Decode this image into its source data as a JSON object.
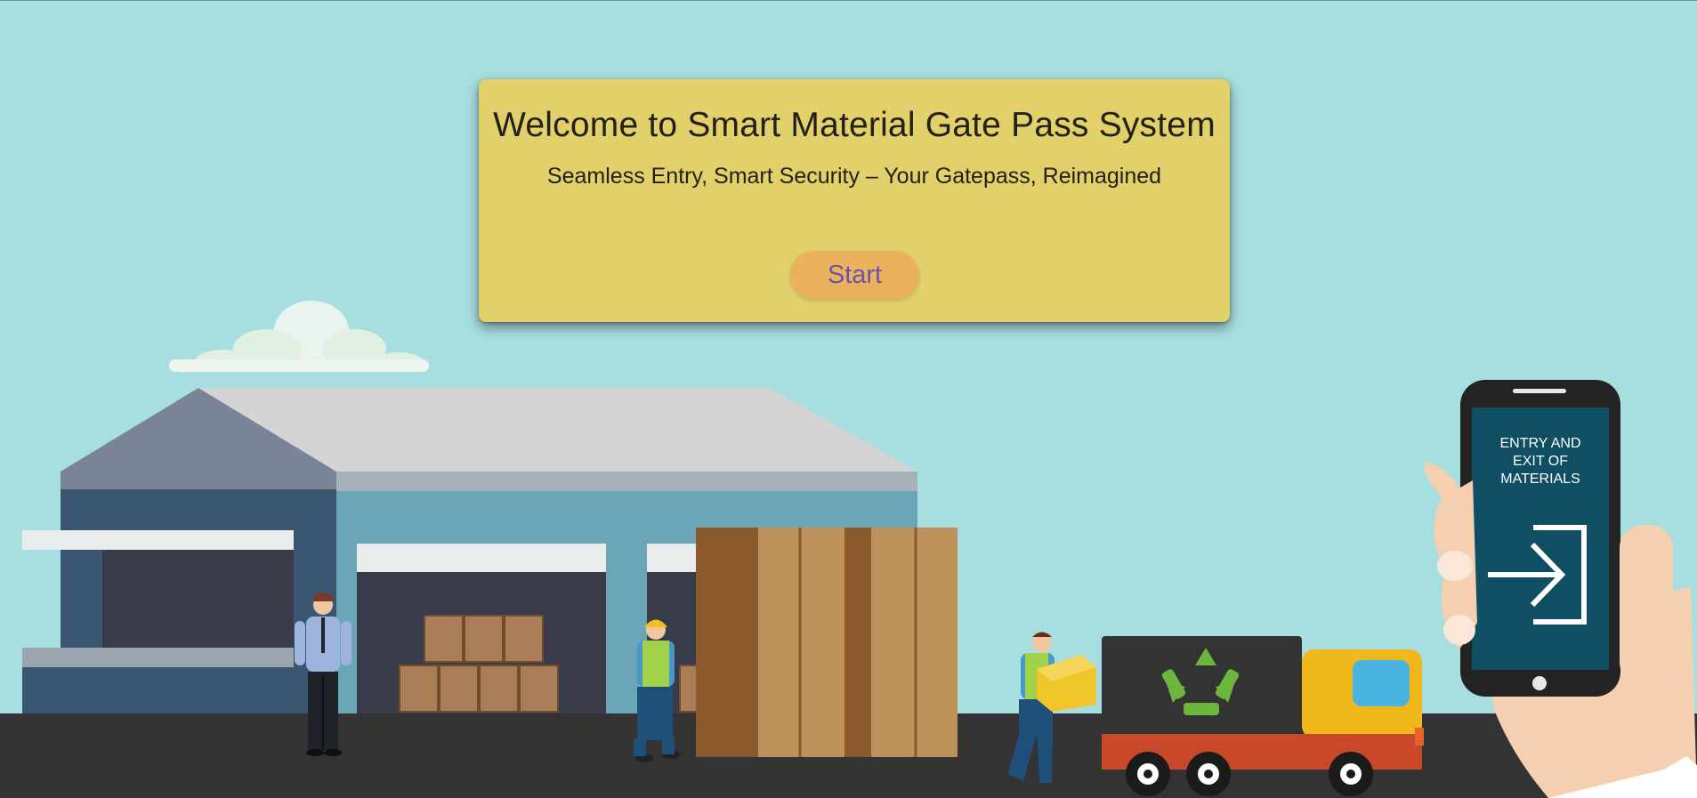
{
  "welcome": {
    "title": "Welcome to Smart Material Gate Pass System",
    "subtitle": "Seamless Entry, Smart Security – Your Gatepass, Reimagined",
    "start_label": "Start"
  },
  "phone_screen": {
    "line1": "ENTRY AND",
    "line2": "EXIT OF",
    "line3": "MATERIALS",
    "icon": "entry-arrow-icon"
  },
  "colors": {
    "sky": "#a7dfe0",
    "card": "#e2d06a",
    "button": "#ebb15d",
    "button_text": "#6a55a8",
    "ground": "#333333"
  }
}
